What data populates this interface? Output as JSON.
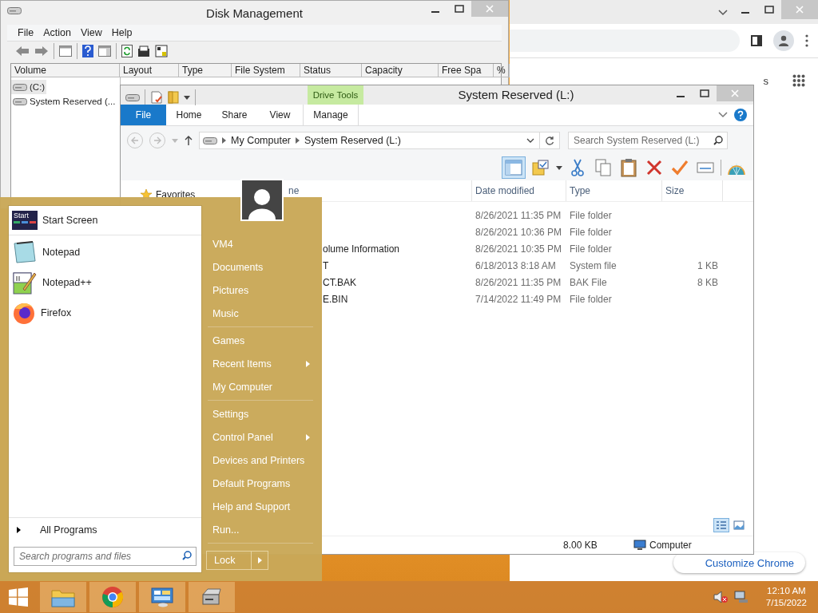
{
  "browser_window": {
    "link_fragment": "s",
    "customize_button": "Customize Chrome"
  },
  "disk_management": {
    "title": "Disk Management",
    "menu": [
      "File",
      "Action",
      "View",
      "Help"
    ],
    "columns": [
      "Volume",
      "Layout",
      "Type",
      "File System",
      "Status",
      "Capacity",
      "Free Spa",
      "%"
    ],
    "volumes": [
      {
        "label": "(C:)",
        "selected": true
      },
      {
        "label": "System Reserved (...",
        "selected": false
      }
    ]
  },
  "explorer": {
    "title": "System Reserved (L:)",
    "contextual_tab": "Drive Tools",
    "tabs": [
      {
        "label": "File",
        "selected": true
      },
      {
        "label": "Home",
        "selected": false
      },
      {
        "label": "Share",
        "selected": false
      },
      {
        "label": "View",
        "selected": false
      },
      {
        "label": "Manage",
        "selected": false
      }
    ],
    "breadcrumb": [
      "My Computer",
      "System Reserved (L:)"
    ],
    "search": {
      "placeholder": "Search System Reserved (L:)"
    },
    "nav": [
      "Favorites"
    ],
    "columns": [
      "ne",
      "Date modified",
      "Type",
      "Size"
    ],
    "files": [
      {
        "date": "8/26/2021 11:35 PM",
        "type": "File folder"
      },
      {
        "date": "8/26/2021 10:36 PM",
        "type": "File folder"
      },
      {
        "name": "olume Information",
        "date": "8/26/2021 10:35 PM",
        "type": "File folder"
      },
      {
        "name": "T",
        "date": "6/18/2013 8:18 AM",
        "type": "System file",
        "size": "1 KB"
      },
      {
        "name": "CT.BAK",
        "date": "8/26/2021 11:35 PM",
        "type": "BAK File",
        "size": "8 KB"
      },
      {
        "name": "E.BIN",
        "date": "7/14/2022 11:49 PM",
        "type": "File folder"
      }
    ],
    "status": {
      "size": "8.00 KB",
      "location": "Computer"
    }
  },
  "start_menu": {
    "pinned": [
      {
        "label": "Start Screen",
        "kind": "tile",
        "icon_text": "Start"
      },
      {
        "label": "Notepad",
        "kind": "notepad"
      },
      {
        "label": "Notepad++",
        "kind": "notepadpp"
      },
      {
        "label": "Firefox",
        "kind": "firefox"
      }
    ],
    "all_programs": "All Programs",
    "search": {
      "placeholder": "Search programs and files"
    },
    "groups": [
      {
        "items": [
          {
            "label": "VM4",
            "submenu": false
          },
          {
            "label": "Documents",
            "submenu": false
          },
          {
            "label": "Pictures",
            "submenu": false
          },
          {
            "label": "Music",
            "submenu": false
          }
        ]
      },
      {
        "items": [
          {
            "label": "Games",
            "submenu": false
          },
          {
            "label": "Recent Items",
            "submenu": true
          },
          {
            "label": "My Computer",
            "submenu": false
          }
        ]
      },
      {
        "items": [
          {
            "label": "Settings",
            "submenu": false
          },
          {
            "label": "Control Panel",
            "submenu": true
          },
          {
            "label": "Devices and Printers",
            "submenu": false
          },
          {
            "label": "Default Programs",
            "submenu": false
          },
          {
            "label": "Help and Support",
            "submenu": false
          },
          {
            "label": "Run...",
            "submenu": false
          }
        ]
      }
    ],
    "power_button": "Lock"
  },
  "taskbar": {
    "apps": [
      {
        "kind": "folder"
      },
      {
        "kind": "chrome"
      },
      {
        "kind": "panel"
      },
      {
        "kind": "drive"
      }
    ],
    "clock": {
      "time": "12:10 AM",
      "date": "7/15/2022"
    }
  }
}
